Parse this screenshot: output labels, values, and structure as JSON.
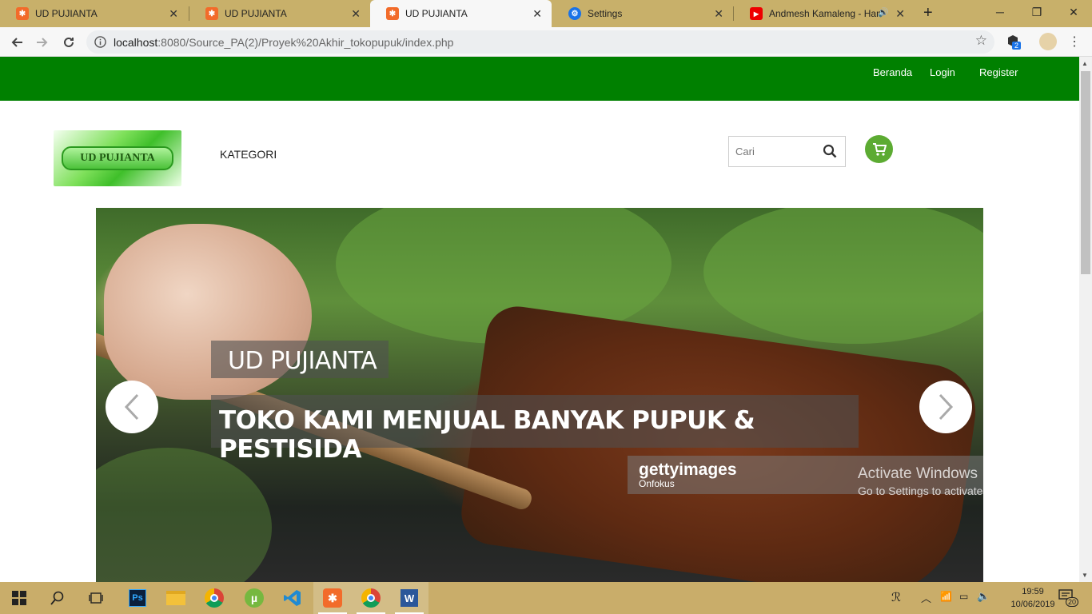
{
  "browser": {
    "tabs": [
      {
        "title": "UD PUJIANTA",
        "icon": "xampp-icon",
        "active": false
      },
      {
        "title": "UD PUJIANTA",
        "icon": "xampp-icon",
        "active": false
      },
      {
        "title": "UD PUJIANTA",
        "icon": "xampp-icon",
        "active": true
      },
      {
        "title": "Settings",
        "icon": "gear-icon",
        "active": false
      },
      {
        "title": "Andmesh Kamaleng - Han",
        "icon": "youtube-icon",
        "active": false
      }
    ],
    "new_tab": "+",
    "url_host": "localhost",
    "url_path": ":8080/Source_PA(2)/Proyek%20Akhir_tokopupuk/index.php",
    "extension_badge": "2",
    "window_controls": {
      "minimize": "─",
      "restore": "❐",
      "close": "✕"
    }
  },
  "site": {
    "topnav": {
      "links": [
        "Beranda",
        "Login",
        "Register"
      ],
      "color": "#008000"
    },
    "logo_text": "UD PUJIANTA",
    "kategori": "KATEGORI",
    "search_placeholder": "Cari",
    "cart_color": "#5cab32"
  },
  "carousel": {
    "caption_title": "UD PUJIANTA",
    "caption_text": "TOKO KAMI MENJUAL BANYAK PUPUK & PESTISIDA",
    "watermark_brand": "gettyimages",
    "watermark_credit": "Onfokus",
    "prev": "‹",
    "next": "›"
  },
  "activation": {
    "line1": "Activate Windows",
    "line2": "Go to Settings to activate Windows."
  },
  "taskbar": {
    "apps": [
      "windows-start-icon",
      "search-icon",
      "task-view-icon",
      "photoshop-icon",
      "file-explorer-icon",
      "chrome-icon",
      "utorrent-icon",
      "vscode-icon",
      "xampp-icon",
      "chrome-icon",
      "word-icon"
    ],
    "time": "19:59",
    "date": "10/06/2019",
    "notifications": "20"
  }
}
